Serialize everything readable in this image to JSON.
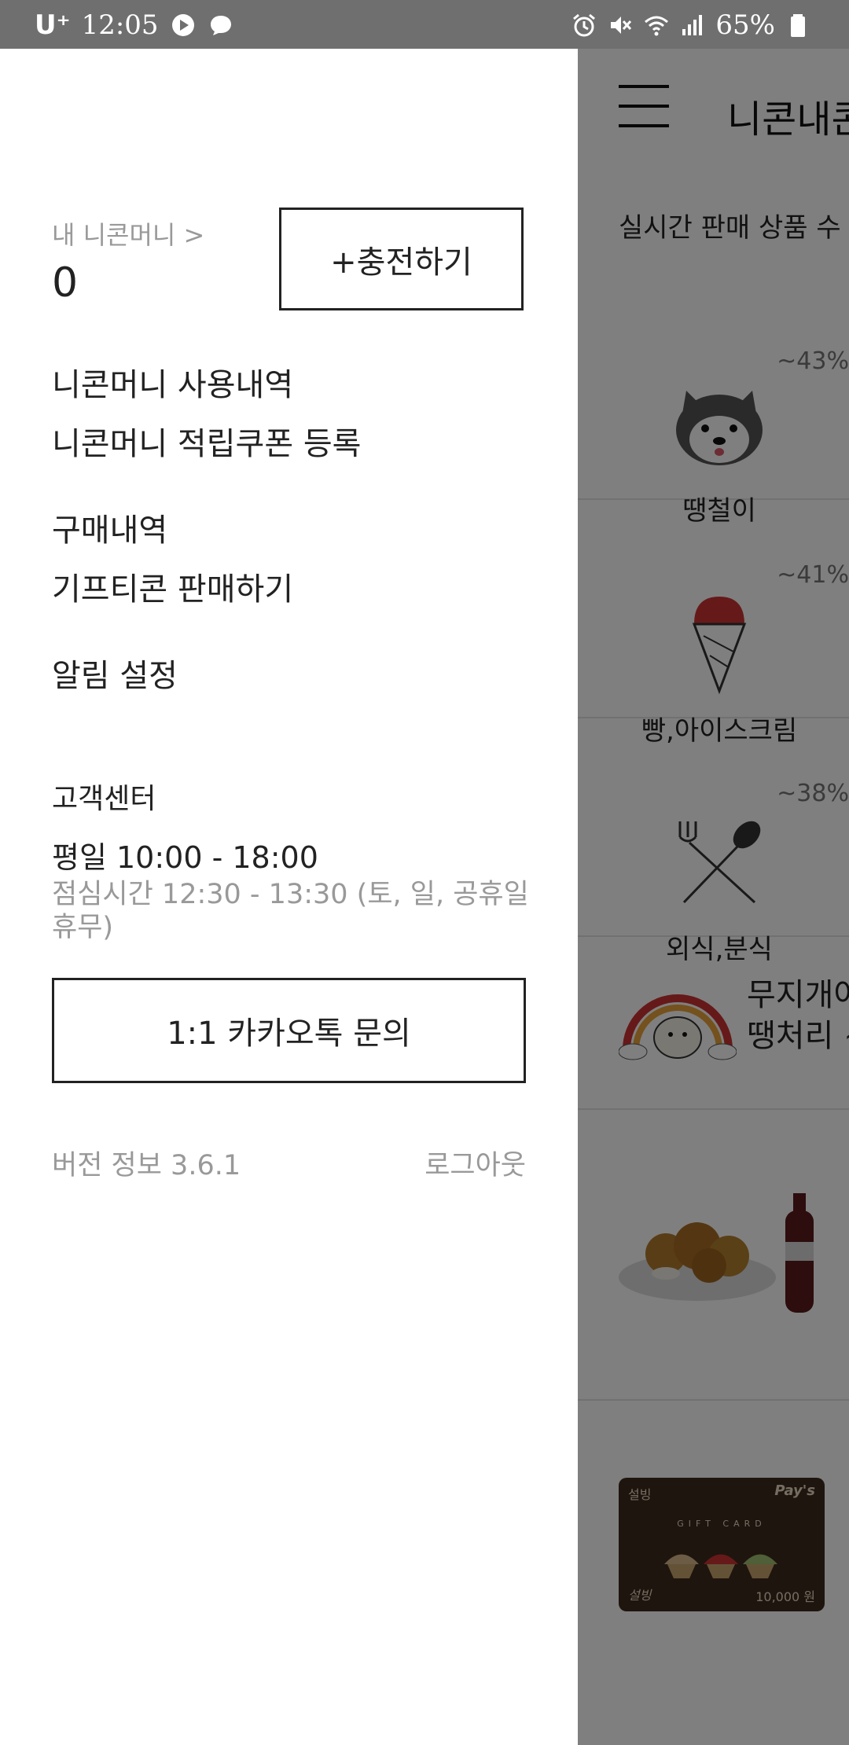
{
  "status_bar": {
    "carrier": "U⁺",
    "time": "12:05",
    "battery": "65%"
  },
  "drawer": {
    "money_link": "내 니콘머니 >",
    "money_amount": "0",
    "charge_button": "+충전하기",
    "menu": [
      "니콘머니 사용내역",
      "니콘머니 적립쿠폰 등록",
      "구매내역",
      "기프티콘 판매하기",
      "알림 설정"
    ],
    "customer_center": {
      "title": "고객센터",
      "hours": "평일 10:00 - 18:00",
      "lunch": "점심시간 12:30 - 13:30 (토, 일, 공휴일 휴무)"
    },
    "kakao_button": "1:1 카카오톡 문의",
    "version": "버전 정보 3.6.1",
    "logout": "로그아웃"
  },
  "background_app": {
    "title": "니콘내콘",
    "realtime_label": "실시간 판매 상품 수",
    "categories": [
      {
        "name": "땡철이",
        "discount": "~43%",
        "icon": "dog-icon"
      },
      {
        "name": "빵,아이스크림",
        "discount": "~41%",
        "icon": "ice-cream-icon"
      },
      {
        "name": "외식,분식",
        "discount": "~38%",
        "icon": "fork-spoon-icon"
      }
    ],
    "promo": {
      "line1": "무지개어",
      "line2": "땡처리 ~"
    },
    "gift_card": {
      "brand": "설빙",
      "pay": "Pay's",
      "label": "GIFT CARD",
      "amount": "10,000 원",
      "signature": "설빙"
    }
  },
  "colors": {
    "status_bar": "#6f6f6f",
    "dim_overlay": "rgba(0,0,0,0.5)",
    "text_primary": "#222222",
    "text_secondary": "#999999"
  }
}
